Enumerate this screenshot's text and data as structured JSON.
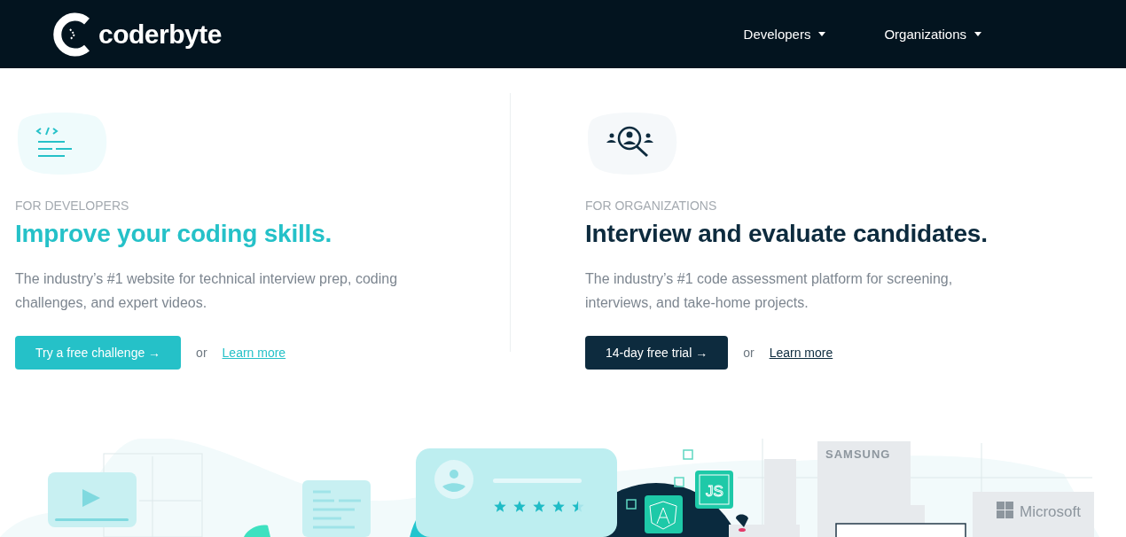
{
  "header": {
    "logo": "coderbyte",
    "nav": [
      {
        "label": "Developers"
      },
      {
        "label": "Organizations"
      }
    ]
  },
  "sections": [
    {
      "kind": "developers",
      "eyebrow": "FOR DEVELOPERS",
      "heading": "Improve your coding skills.",
      "text": "The industry’s #1 website for technical interview prep, coding challenges, and expert videos.",
      "button": "Try a free challenge →",
      "or": "or",
      "link": "Learn more"
    },
    {
      "kind": "organizations",
      "eyebrow": "FOR ORGANIZATIONS",
      "heading": "Interview and evaluate candidates.",
      "text": "The industry’s #1 code assessment platform for screening, interviews, and take-home projects.",
      "button": "14-day free trial →",
      "or": "or",
      "link": "Learn more"
    }
  ],
  "illustration": {
    "stars": 4.5,
    "badge": "JS",
    "brands": [
      "SAMSUNG",
      "Microsoft"
    ]
  }
}
